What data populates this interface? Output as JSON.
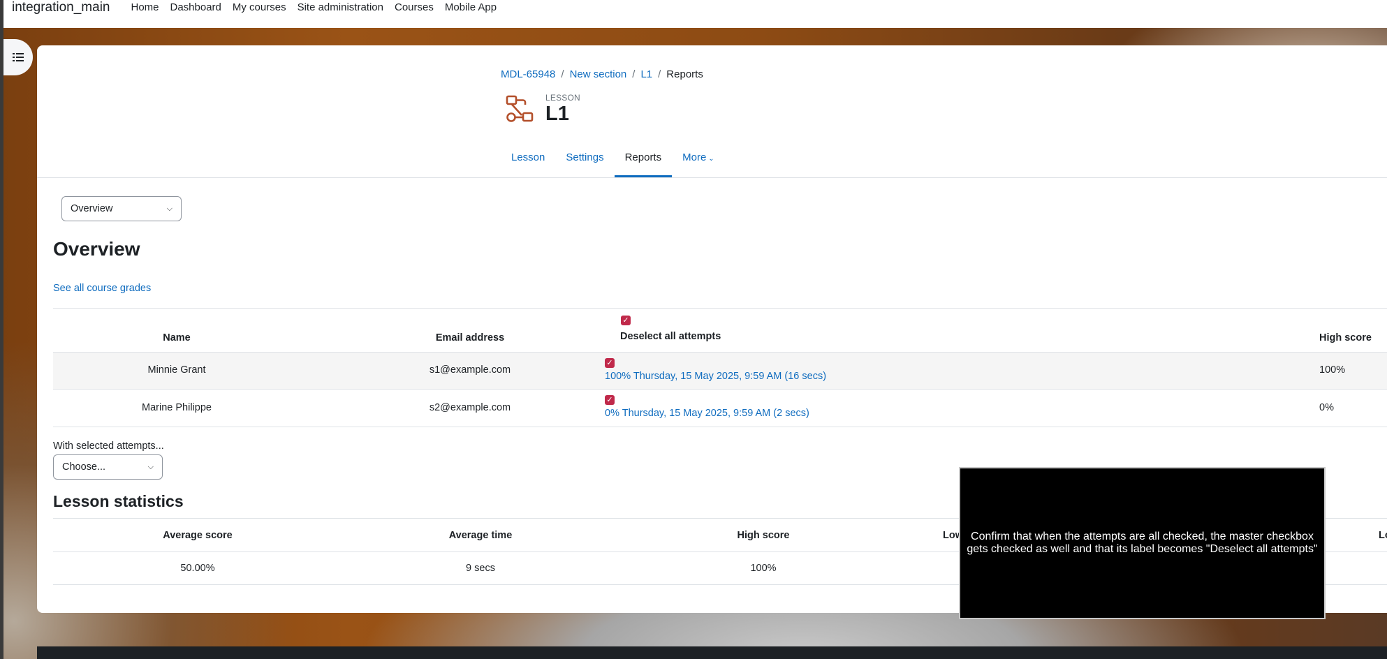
{
  "navbar": {
    "brand": "integration_main",
    "links": [
      "Home",
      "Dashboard",
      "My courses",
      "Site administration",
      "Courses",
      "Mobile App"
    ]
  },
  "breadcrumb": {
    "items": [
      "MDL-65948",
      "New section",
      "L1"
    ],
    "current": "Reports"
  },
  "activity": {
    "type": "LESSON",
    "name": "L1"
  },
  "tabs": {
    "lesson": "Lesson",
    "settings": "Settings",
    "reports": "Reports",
    "more": "More"
  },
  "report_select": {
    "value": "Overview"
  },
  "overview": {
    "heading": "Overview",
    "grades_link": "See all course grades",
    "columns": {
      "name": "Name",
      "email": "Email address",
      "master_label": "Deselect all attempts",
      "high_score": "High score"
    },
    "rows": [
      {
        "name": "Minnie Grant",
        "email": "s1@example.com",
        "attempt": "100% Thursday, 15 May 2025, 9:59 AM (16 secs)",
        "high_score": "100%"
      },
      {
        "name": "Marine Philippe",
        "email": "s2@example.com",
        "attempt": "0% Thursday, 15 May 2025, 9:59 AM (2 secs)",
        "high_score": "0%"
      }
    ]
  },
  "with_selected": {
    "label": "With selected attempts...",
    "value": "Choose..."
  },
  "statistics": {
    "heading": "Lesson statistics",
    "columns": {
      "average_score": "Average score",
      "average_time": "Average time",
      "high_score": "High score",
      "low_score": "Low",
      "last": "Lo"
    },
    "values": {
      "average_score": "50.00%",
      "average_time": "9 secs",
      "high_score": "100%"
    }
  },
  "overlay": {
    "text": "Confirm that when the attempts are all checked, the master checkbox gets checked as well and that its label becomes \"Deselect all attempts\""
  },
  "colors": {
    "link": "#0f6cbf",
    "checkbox": "#c0294a",
    "activity_icon": "#b34f2a"
  }
}
